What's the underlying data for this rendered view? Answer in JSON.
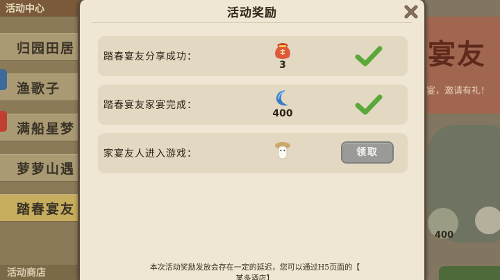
{
  "background": {
    "left_header": "活动中心",
    "menu_items": [
      {
        "label": "归园田居",
        "active": false
      },
      {
        "label": "渔歌子",
        "active": false
      },
      {
        "label": "满船星梦",
        "active": false
      },
      {
        "label": "萝萝山遇",
        "active": false
      },
      {
        "label": "踏春宴友",
        "active": true
      }
    ],
    "left_bottom": "活动商店",
    "right_title": "宴友",
    "right_sub": "宴，邀请有礼！",
    "right_count": "400"
  },
  "modal": {
    "title": "活动奖励",
    "rows": [
      {
        "label": "踏春宴友分享成功：",
        "reward_icon": "red-pouch-icon",
        "qty": "3",
        "status": "completed"
      },
      {
        "label": "踏春宴友家宴完成：",
        "reward_icon": "crescent-moon-icon",
        "qty": "400",
        "status": "completed"
      },
      {
        "label": "家宴友人进入游戏：",
        "reward_icon": "mushroom-spirit-icon",
        "qty": "",
        "status": "claim",
        "claim_label": "领取"
      }
    ],
    "footer": "本次活动奖励发放会存在一定的延迟，您可以通过H5页面的【",
    "footer2": "某多酒店】"
  },
  "colors": {
    "modal_bg": "#efe6d4",
    "row_bg": "#e3d8c2",
    "check_green": "#5aa83a",
    "claim_disabled": "#9a9a98"
  }
}
